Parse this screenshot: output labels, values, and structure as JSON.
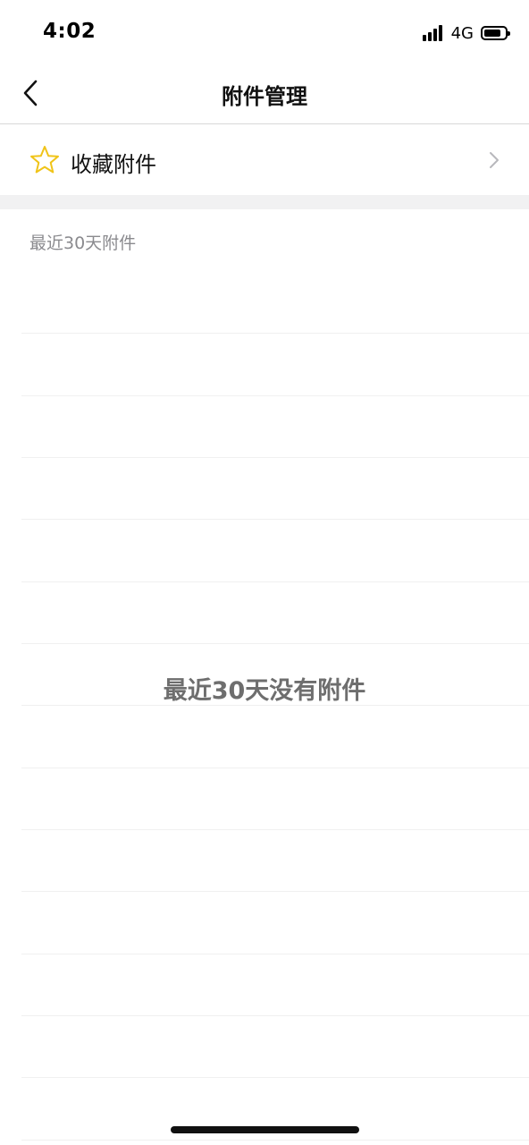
{
  "status_bar": {
    "time": "4:02",
    "network": "4G",
    "icons": [
      "signal-icon",
      "battery-icon"
    ]
  },
  "nav": {
    "title": "附件管理",
    "back_icon": "chevron-left-icon"
  },
  "favorites": {
    "label": "收藏附件",
    "icon": "star-icon",
    "icon_color": "#f0c419",
    "chevron_icon": "chevron-right-icon"
  },
  "recent": {
    "header": "最近30天附件",
    "empty_message": "最近30天没有附件"
  },
  "colors": {
    "accent": "#f0c419",
    "divider": "#f0f0f0",
    "section_gap": "#f1f1f2",
    "secondary_text": "#8a8a8e"
  }
}
